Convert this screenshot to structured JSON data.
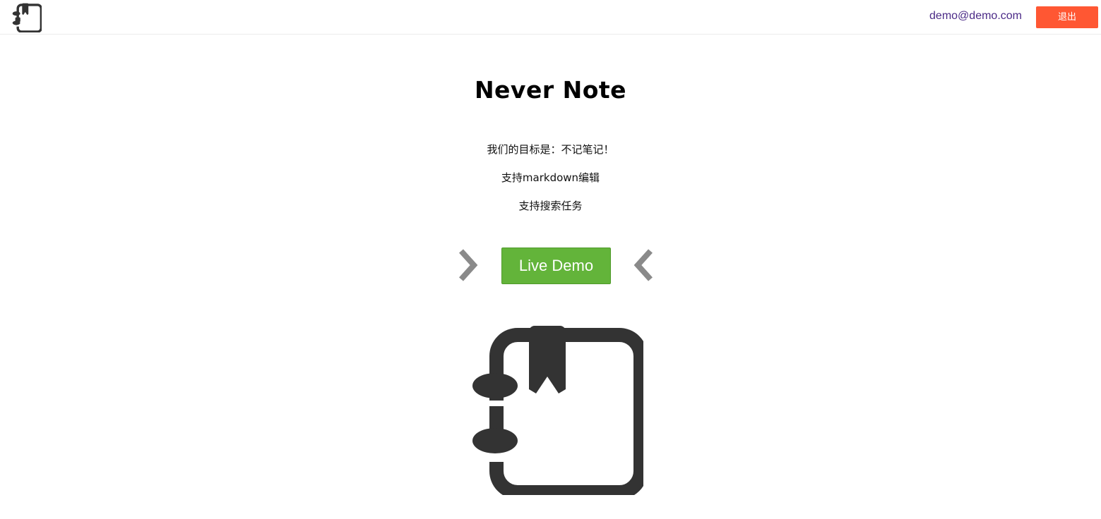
{
  "header": {
    "logo_icon": "notebook-bookmark-icon",
    "user_email": "demo@demo.com",
    "logout_label": "退出",
    "logout_color": "#ff5733",
    "email_color": "#4b2a87"
  },
  "main": {
    "title": "Never Note",
    "lines": [
      "我们的目标是：不记笔记！",
      "支持markdown编辑",
      "支持搜索任务"
    ],
    "demo_button_label": "Live Demo",
    "demo_button_color": "#63b43a",
    "left_arrow_icon": "chevron-right-icon",
    "right_arrow_icon": "chevron-left-icon",
    "hero_icon": "notebook-bookmark-icon"
  }
}
